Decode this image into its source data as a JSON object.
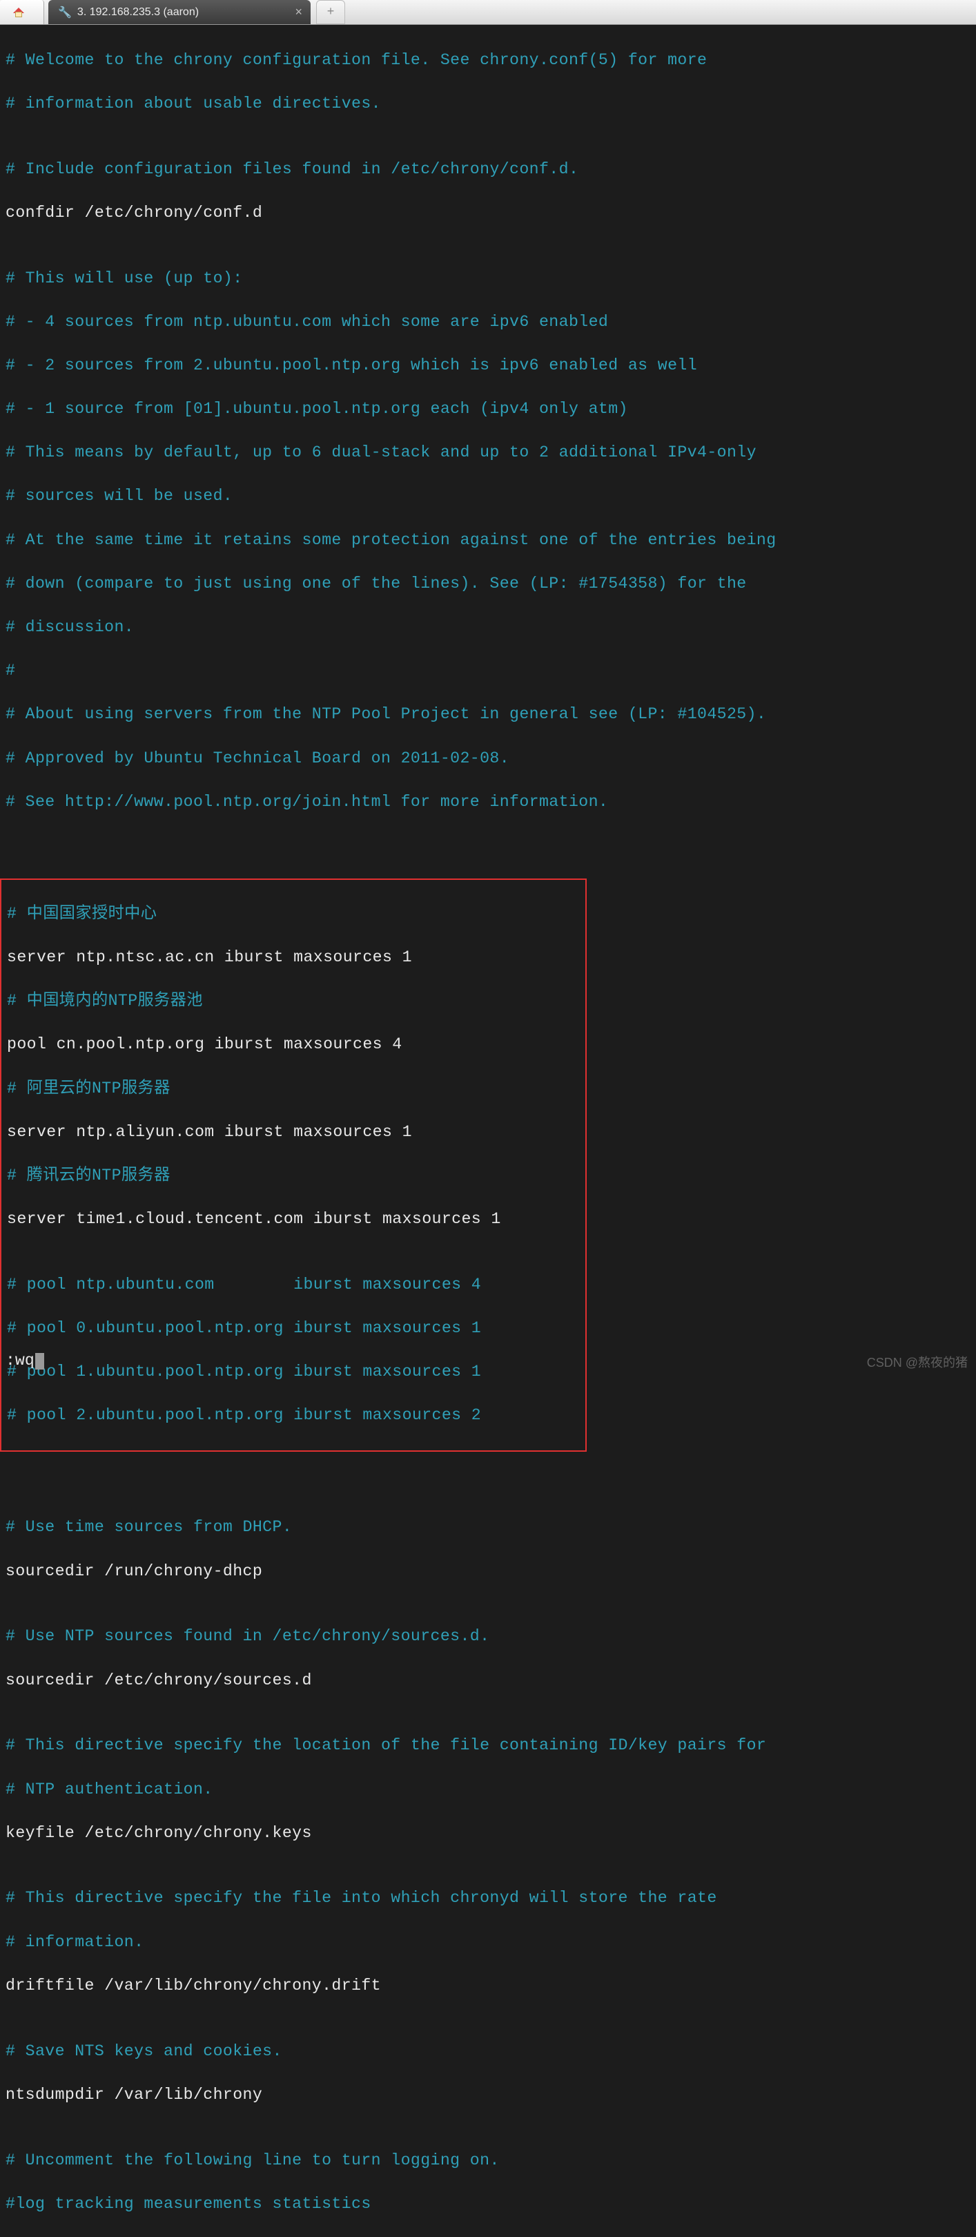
{
  "tabs": {
    "session_title": "3. 192.168.235.3 (aaron)",
    "close_glyph": "×",
    "plus_glyph": "+"
  },
  "terminal": {
    "top_comments": [
      "# Welcome to the chrony configuration file. See chrony.conf(5) for more",
      "# information about usable directives."
    ],
    "blank1": "",
    "include_comment": "# Include configuration files found in /etc/chrony/conf.d.",
    "confdir": "confdir /etc/chrony/conf.d",
    "blank2": "",
    "use_block": [
      "# This will use (up to):",
      "# - 4 sources from ntp.ubuntu.com which some are ipv6 enabled",
      "# - 2 sources from 2.ubuntu.pool.ntp.org which is ipv6 enabled as well",
      "# - 1 source from [01].ubuntu.pool.ntp.org each (ipv4 only atm)",
      "# This means by default, up to 6 dual-stack and up to 2 additional IPv4-only",
      "# sources will be used.",
      "# At the same time it retains some protection against one of the entries being",
      "# down (compare to just using one of the lines). See (LP: #1754358) for the",
      "# discussion.",
      "#",
      "# About using servers from the NTP Pool Project in general see (LP: #104525).",
      "# Approved by Ubuntu Technical Board on 2011-02-08.",
      "# See http://www.pool.ntp.org/join.html for more information."
    ],
    "blank3": "",
    "box": {
      "c1": "# 中国国家授时中心",
      "s1": "server ntp.ntsc.ac.cn iburst maxsources 1",
      "c2": "# 中国境内的NTP服务器池",
      "s2": "pool cn.pool.ntp.org iburst maxsources 4",
      "c3": "# 阿里云的NTP服务器",
      "s3": "server ntp.aliyun.com iburst maxsources 1",
      "c4": "# 腾讯云的NTP服务器",
      "s4": "server time1.cloud.tencent.com iburst maxsources 1",
      "blank": "",
      "p1": "# pool ntp.ubuntu.com        iburst maxsources 4",
      "p2": "# pool 0.ubuntu.pool.ntp.org iburst maxsources 1",
      "p3": "# pool 1.ubuntu.pool.ntp.org iburst maxsources 1",
      "p4": "# pool 2.ubuntu.pool.ntp.org iburst maxsources 2"
    },
    "blank4": "",
    "dhcp_comment": "# Use time sources from DHCP.",
    "dhcp_line": "sourcedir /run/chrony-dhcp",
    "blank5": "",
    "sources_comment": "# Use NTP sources found in /etc/chrony/sources.d.",
    "sources_line": "sourcedir /etc/chrony/sources.d",
    "blank6": "",
    "key_c1": "# This directive specify the location of the file containing ID/key pairs for",
    "key_c2": "# NTP authentication.",
    "key_line": "keyfile /etc/chrony/chrony.keys",
    "blank7": "",
    "drift_c1": "# This directive specify the file into which chronyd will store the rate",
    "drift_c2": "# information.",
    "drift_line": "driftfile /var/lib/chrony/chrony.drift",
    "blank8": "",
    "nts_comment": "# Save NTS keys and cookies.",
    "nts_line": "ntsdumpdir /var/lib/chrony",
    "blank9": "",
    "log_c1": "# Uncomment the following line to turn logging on.",
    "log_c2": "#log tracking measurements statistics"
  },
  "vim_command": ":wq",
  "watermark": "CSDN @熬夜的猪"
}
